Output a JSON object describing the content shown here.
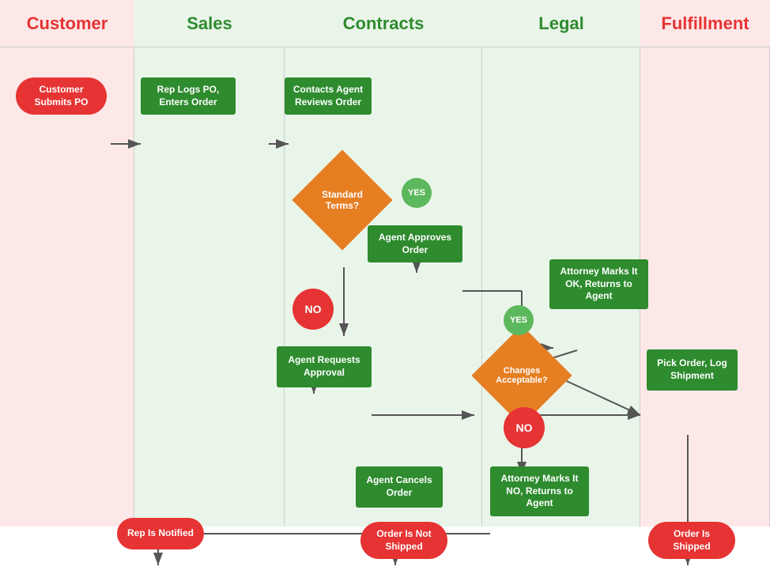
{
  "lanes": [
    {
      "id": "customer",
      "label": "Customer",
      "type": "customer"
    },
    {
      "id": "sales",
      "label": "Sales",
      "type": "sales"
    },
    {
      "id": "contracts",
      "label": "Contracts",
      "type": "contracts"
    },
    {
      "id": "legal",
      "label": "Legal",
      "type": "legal"
    },
    {
      "id": "fulfillment",
      "label": "Fulfillment",
      "type": "fulfillment"
    }
  ],
  "nodes": {
    "customer_submits": "Customer Submits PO",
    "rep_logs": "Rep Logs PO, Enters Order",
    "contacts_agent": "Contacts Agent Reviews Order",
    "standard_terms": "Standard Terms?",
    "yes_standard": "YES",
    "agent_approves": "Agent Approves Order",
    "no_standard": "NO",
    "agent_requests": "Agent Requests Approval",
    "changes_acceptable": "Changes Acceptable?",
    "yes_changes": "YES",
    "no_changes": "NO",
    "attorney_ok": "Attorney Marks It OK, Returns to Agent",
    "attorney_no": "Attorney Marks It NO, Returns to Agent",
    "agent_cancels": "Agent Cancels Order",
    "pick_order": "Pick Order, Log Shipment",
    "rep_notified": "Rep Is Notified",
    "order_not_shipped": "Order Is Not Shipped",
    "order_shipped": "Order Is Shipped"
  }
}
